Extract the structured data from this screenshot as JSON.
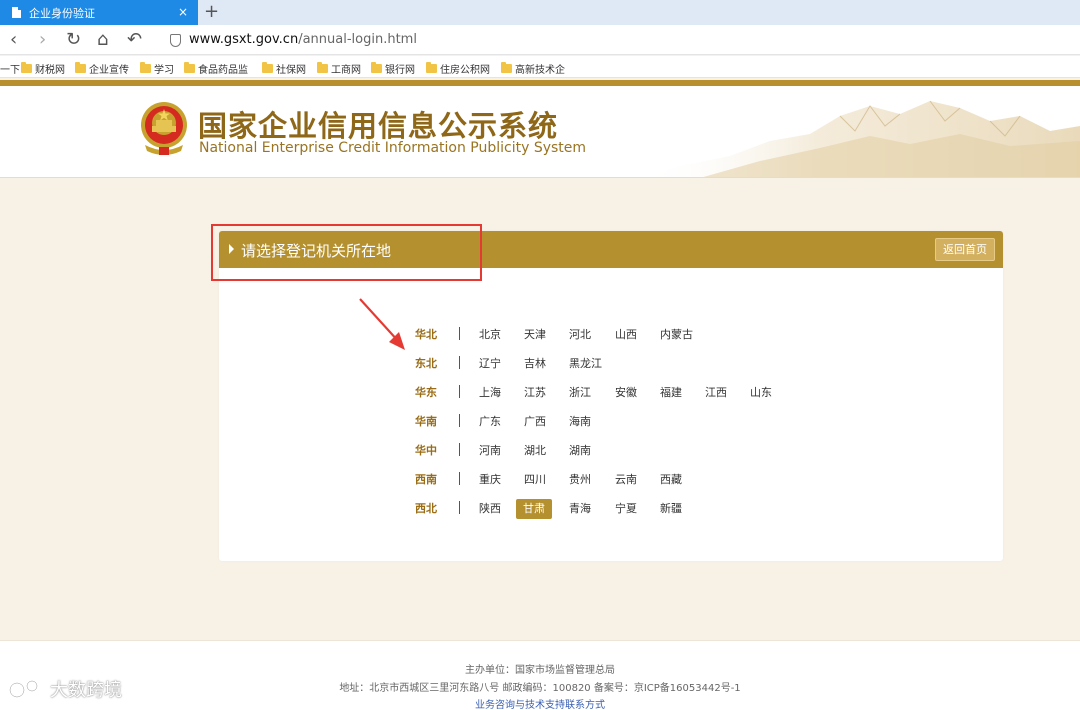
{
  "browser": {
    "tab_title": "企业身份验证",
    "tab_close": "×",
    "new_tab": "+",
    "url_host": "www.gsxt.gov.cn",
    "url_path": "/annual-login.html",
    "nav": {
      "back": "‹",
      "forward": "›",
      "reload": "↻",
      "home": "⌂",
      "undo": "↶"
    },
    "bookmarks": {
      "first": "一下",
      "items": [
        "财税网",
        "企业宣传",
        "学习",
        "食品药品监",
        "社保网",
        "工商网",
        "银行网",
        "住房公积网",
        "高新技术企"
      ]
    }
  },
  "header": {
    "title_cn": "国家企业信用信息公示系统",
    "title_en": "National Enterprise Credit Information Publicity System"
  },
  "panel": {
    "title": "请选择登记机关所在地",
    "return_label": "返回首页"
  },
  "regions": [
    {
      "name": "华北",
      "provinces": [
        "北京",
        "天津",
        "河北",
        "山西",
        "内蒙古"
      ]
    },
    {
      "name": "东北",
      "provinces": [
        "辽宁",
        "吉林",
        "黑龙江"
      ]
    },
    {
      "name": "华东",
      "provinces": [
        "上海",
        "江苏",
        "浙江",
        "安徽",
        "福建",
        "江西",
        "山东"
      ]
    },
    {
      "name": "华南",
      "provinces": [
        "广东",
        "广西",
        "海南"
      ]
    },
    {
      "name": "华中",
      "provinces": [
        "河南",
        "湖北",
        "湖南"
      ]
    },
    {
      "name": "西南",
      "provinces": [
        "重庆",
        "四川",
        "贵州",
        "云南",
        "西藏"
      ]
    },
    {
      "name": "西北",
      "provinces": [
        "陕西",
        "甘肃",
        "青海",
        "宁夏",
        "新疆"
      ]
    }
  ],
  "selected_province": "甘肃",
  "footer": {
    "sponsor": "主办单位：国家市场监督管理总局",
    "address": "地址：北京市西城区三里河东路八号   邮政编码：100820   备案号：京ICP备16053442号-1",
    "contact": "业务咨询与技术支持联系方式"
  },
  "watermark": "大数跨境",
  "colors": {
    "gold": "#b5902f",
    "tab_blue": "#1e8ae6",
    "highlight_red": "#e53a33"
  }
}
